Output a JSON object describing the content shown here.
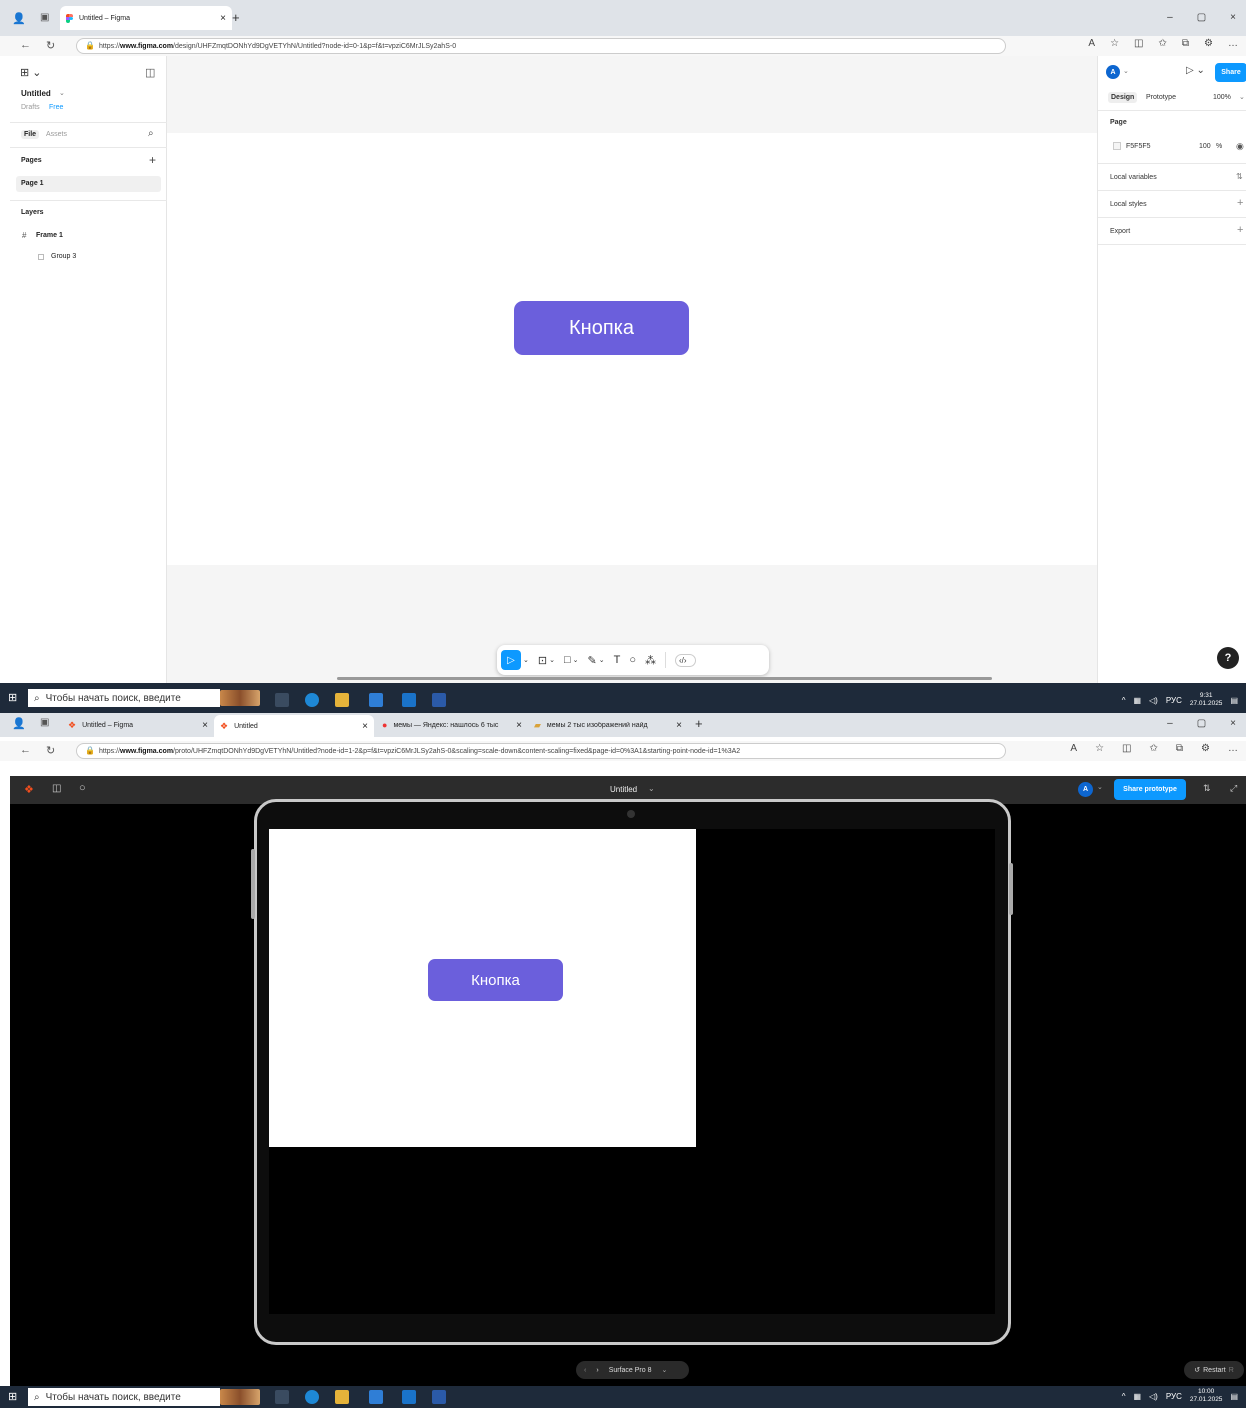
{
  "shot1": {
    "tabs": [
      {
        "title": "Untitled – Figma",
        "close": "×"
      }
    ],
    "new_tab": "+",
    "window_controls": [
      "–",
      "▢",
      "×"
    ],
    "url_prefix": "https://",
    "url_host": "www.figma.com",
    "url_path": "/design/UHFZmqtDONhYd9DgVETYhN/Untitled?node-id=0-1&p=f&t=vpziC6MrJLSy2ahS-0",
    "left_panel": {
      "file_name": "Untitled",
      "drafts": "Drafts",
      "plan": "Free",
      "tab_file": "File",
      "tab_assets": "Assets",
      "pages_heading": "Pages",
      "page_item": "Page 1",
      "layers_heading": "Layers",
      "layer_frame": "Frame 1",
      "layer_group": "Group 3"
    },
    "right_panel": {
      "avatar": "A",
      "share": "Share",
      "tab_design": "Design",
      "tab_prototype": "Prototype",
      "zoom": "100%",
      "page_heading": "Page",
      "page_color": "F5F5F5",
      "page_opacity": "100",
      "opacity_unit": "%",
      "local_variables": "Local variables",
      "local_styles": "Local styles",
      "export": "Export"
    },
    "canvas_button": "Кнопка",
    "help": "?"
  },
  "taskbar1": {
    "search_placeholder": "Чтобы начать поиск, введите",
    "lang": "РУС",
    "time": "9:31",
    "date": "27.01.2025"
  },
  "shot2": {
    "tabs": [
      {
        "title": "Untitled – Figma"
      },
      {
        "title": "Untitled"
      },
      {
        "title": "мемы — Яндекс: нашлось 6 тыс"
      },
      {
        "title": "мемы 2 тыс изображений найд"
      }
    ],
    "new_tab": "+",
    "url_prefix": "https://",
    "url_host": "www.figma.com",
    "url_path": "/proto/UHFZmqtDONhYd9DgVETYhN/Untitled?node-id=1-2&p=f&t=vpziC6MrJLSy2ahS-0&scaling=scale-down&content-scaling=fixed&page-id=0%3A1&starting-point-node-id=1%3A2",
    "proto_title": "Untitled",
    "avatar": "A",
    "share_prototype": "Share prototype",
    "prototype_button": "Кнопка",
    "device_name": "Surface Pro 8",
    "restart": "Restart",
    "restart_key": "R"
  },
  "taskbar2": {
    "search_placeholder": "Чтобы начать поиск, введите",
    "lang": "РУС",
    "time": "10:00",
    "date": "27.01.2025"
  },
  "colors": {
    "accent_purple": "#6b5fdc",
    "figma_blue": "#0d99ff",
    "canvas_gray": "#f5f5f5"
  }
}
